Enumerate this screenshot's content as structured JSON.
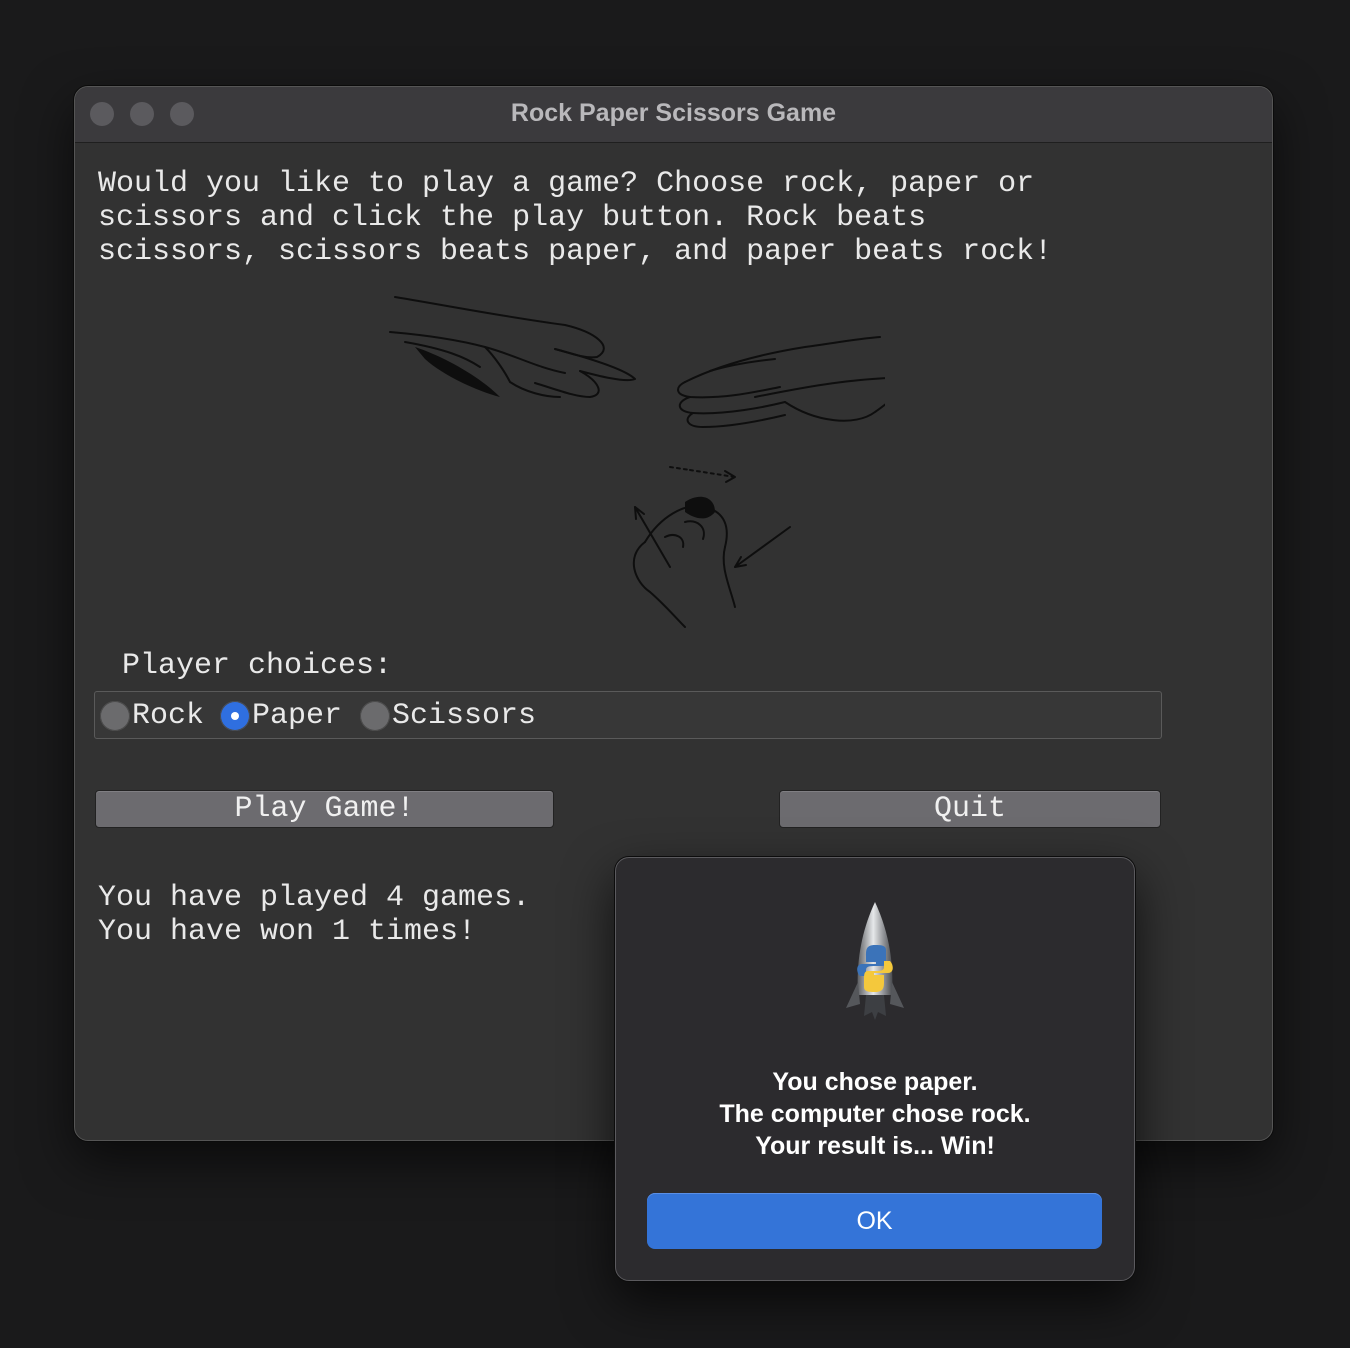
{
  "window": {
    "title": "Rock Paper Scissors Game"
  },
  "intro": {
    "text": "Would you like to play a game? Choose rock, paper or\nscissors and click the play button. Rock beats\nscissors, scissors beats paper, and paper beats rock!"
  },
  "illustration": {
    "description_icon": "rock-paper-scissors-hands-icon"
  },
  "choices": {
    "label": "Player choices:",
    "options": [
      {
        "label": "Rock",
        "selected": false
      },
      {
        "label": "Paper",
        "selected": true
      },
      {
        "label": "Scissors",
        "selected": false
      }
    ]
  },
  "buttons": {
    "play": "Play Game!",
    "quit": "Quit"
  },
  "status": {
    "played": "You have played 4 games.",
    "won": "You have won 1 times!"
  },
  "dialog": {
    "icon": "python-launcher-rocket-icon",
    "line1": "You chose paper.",
    "line2": "The computer chose rock.",
    "line3": "Your result is... Win!",
    "ok": "OK"
  },
  "colors": {
    "accent": "#3474d8",
    "window_bg": "#323232",
    "desktop_bg": "#1a1a1b"
  }
}
